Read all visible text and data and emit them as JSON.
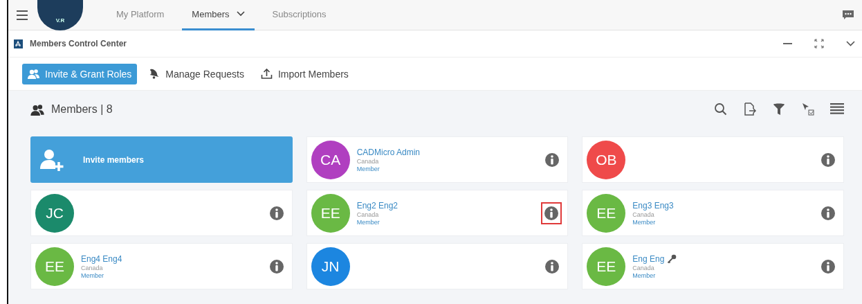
{
  "nav": {
    "logo": "V.R",
    "tabs": [
      {
        "label": "My Platform",
        "selected": false,
        "dropdown": false
      },
      {
        "label": "Members",
        "selected": true,
        "dropdown": true
      },
      {
        "label": "Subscriptions",
        "selected": false,
        "dropdown": false
      }
    ]
  },
  "panel": {
    "title": "Members Control Center"
  },
  "actions": [
    {
      "label": "Invite & Grant Roles",
      "selected": true,
      "kind": "users"
    },
    {
      "label": "Manage Requests",
      "selected": false,
      "kind": "bell"
    },
    {
      "label": "Import Members",
      "selected": false,
      "kind": "upload"
    }
  ],
  "members_header": {
    "title": "Members | 8"
  },
  "cards": [
    {
      "kind": "invite",
      "label": "Invite members"
    },
    {
      "kind": "member",
      "initials": "CA",
      "color": "#b03fc0",
      "name": "CADMicro Admin",
      "country": "Canada",
      "role": "Member",
      "highlighted": false,
      "key": false
    },
    {
      "kind": "member",
      "initials": "OB",
      "color": "#ef4a4a",
      "highlighted": false
    },
    {
      "kind": "member",
      "initials": "JC",
      "color": "#1b8a6b",
      "highlighted": false
    },
    {
      "kind": "member",
      "initials": "EE",
      "color": "#6ab944",
      "name": "Eng2 Eng2",
      "country": "Canada",
      "role": "Member",
      "highlighted": true,
      "key": false
    },
    {
      "kind": "member",
      "initials": "EE",
      "color": "#6ab944",
      "name": "Eng3 Eng3",
      "country": "Canada",
      "role": "Member",
      "highlighted": false,
      "key": false
    },
    {
      "kind": "member",
      "initials": "EE",
      "color": "#6ab944",
      "name": "Eng4 Eng4",
      "country": "Canada",
      "role": "Member",
      "highlighted": false,
      "key": false
    },
    {
      "kind": "member",
      "initials": "JN",
      "color": "#1c86e0",
      "highlighted": false
    },
    {
      "kind": "member",
      "initials": "EE",
      "color": "#6ab944",
      "name": "Eng Eng",
      "country": "Canada",
      "role": "Member",
      "highlighted": false,
      "key": true
    }
  ]
}
